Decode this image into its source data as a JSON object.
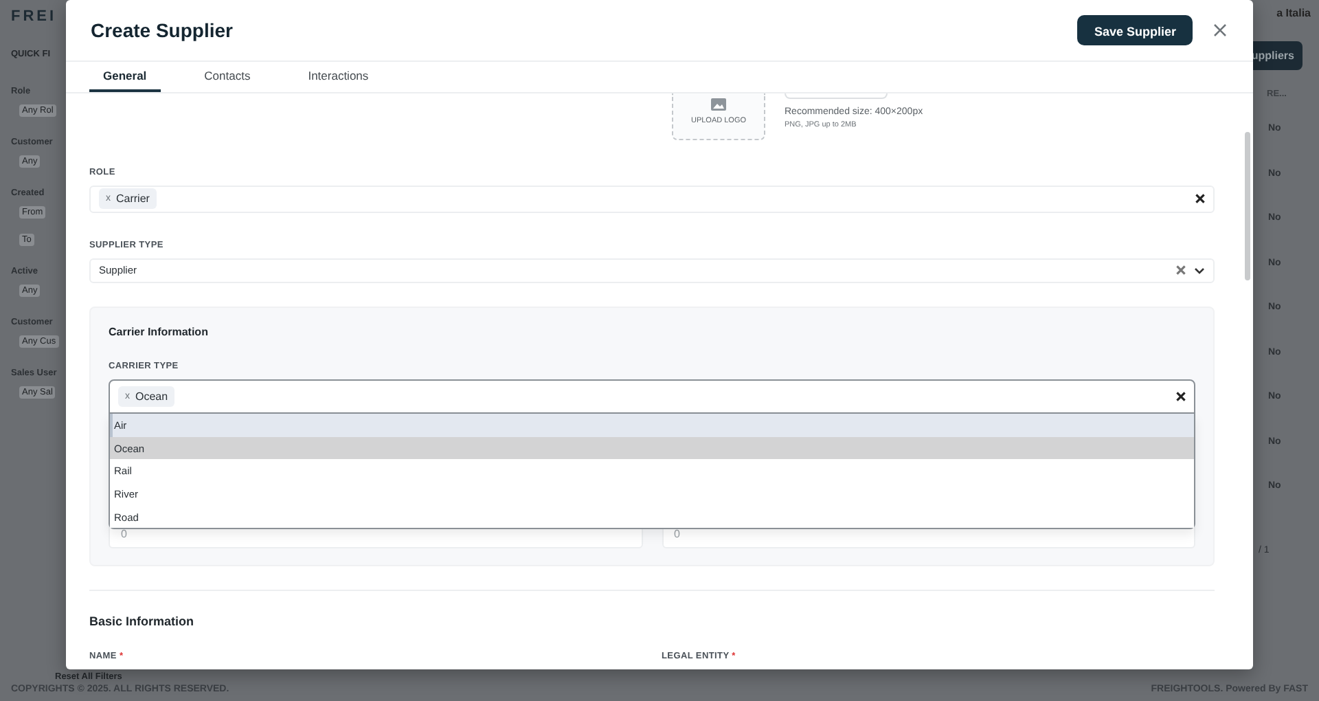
{
  "background": {
    "logo": "FREI",
    "sidebar_title": "QUICK FI",
    "filters": [
      {
        "label": "Role",
        "fields": [
          "Any Rol"
        ]
      },
      {
        "label": "Customer",
        "fields": [
          "Any"
        ]
      },
      {
        "label": "Created",
        "fields": [
          "From",
          "To"
        ]
      },
      {
        "label": "Active",
        "fields": [
          "Any"
        ]
      },
      {
        "label": "Customer",
        "fields": [
          "Any Cus"
        ]
      },
      {
        "label": "Sales User",
        "fields": [
          "Any Sal"
        ]
      }
    ],
    "reset": "Reset All Filters",
    "copyright": "COPYRIGHTS © 2025. ALL RIGHTS RESERVED.",
    "account": "a Italia",
    "action_button": "uppliers",
    "column_header": "RE...",
    "rows": [
      "No",
      "No",
      "No",
      "No",
      "No",
      "No",
      "No",
      "No",
      "No"
    ],
    "pagination": "/ 1",
    "credit": "FREIGHTOOLS. Powered By FAST"
  },
  "modal": {
    "title": "Create Supplier",
    "save_button": "Save Supplier",
    "tabs": [
      {
        "label": "General",
        "selected": true
      },
      {
        "label": "Contacts",
        "selected": false
      },
      {
        "label": "Interactions",
        "selected": false
      }
    ],
    "logo": {
      "label": "UPLOAD LOGO",
      "hint": "Recommended size: 400×200px",
      "formats": "PNG, JPG up to 2MB"
    },
    "role": {
      "label": "ROLE",
      "chips": [
        {
          "remove": "x",
          "label": "Carrier"
        }
      ]
    },
    "supplier_type": {
      "label": "SUPPLIER TYPE",
      "value": "Supplier"
    },
    "carrier": {
      "title": "Carrier Information",
      "label": "CARRIER TYPE",
      "chips": [
        {
          "remove": "x",
          "label": "Ocean"
        }
      ],
      "options": [
        {
          "label": "Air",
          "selected": false,
          "highlighted": true
        },
        {
          "label": "Ocean",
          "selected": true,
          "highlighted": false
        },
        {
          "label": "Rail",
          "selected": false,
          "highlighted": false
        },
        {
          "label": "River",
          "selected": false,
          "highlighted": false
        },
        {
          "label": "Road",
          "selected": false,
          "highlighted": false
        }
      ],
      "fields": [
        "0",
        "0"
      ]
    },
    "basic": {
      "title": "Basic Information",
      "fields": [
        {
          "label": "NAME",
          "mark": "*"
        },
        {
          "label": "LEGAL ENTITY",
          "mark": "*"
        }
      ]
    }
  }
}
